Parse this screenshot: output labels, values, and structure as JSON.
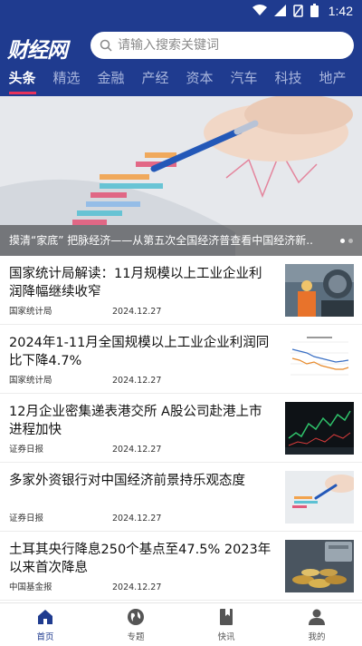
{
  "status_bar": {
    "time": "1:42",
    "icons": [
      "wifi-icon",
      "signal-icon",
      "no-sim-icon",
      "battery-icon"
    ]
  },
  "header": {
    "logo_text": "财经网",
    "search": {
      "placeholder": "请输入搜索关键词"
    },
    "tabs": [
      {
        "label": "头条",
        "active": true
      },
      {
        "label": "精选"
      },
      {
        "label": "金融"
      },
      {
        "label": "产经"
      },
      {
        "label": "资本"
      },
      {
        "label": "汽车"
      },
      {
        "label": "科技"
      },
      {
        "label": "地产"
      }
    ]
  },
  "banner": {
    "caption": "摸清“家底” 把脉经济——从第五次全国经济普查看中国经济新..",
    "slide_count": 2,
    "active_slide": 0
  },
  "news": [
    {
      "title": "国家统计局解读：11月规模以上工业企业利润降幅继续收窄",
      "source": "国家统计局",
      "date": "2024.12.27",
      "thumb": "factory-worker"
    },
    {
      "title": "2024年1-11月全国规模以上工业企业利润同比下降4.7%",
      "source": "国家统计局",
      "date": "2024.12.27",
      "thumb": "line-chart"
    },
    {
      "title": "12月企业密集递表港交所 A股公司赴港上市进程加快",
      "source": "证券日报",
      "date": "2024.12.27",
      "thumb": "stock-screen"
    },
    {
      "title": "多家外资银行对中国经济前景持乐观态度",
      "source": "证券日报",
      "date": "2024.12.27",
      "thumb": "hand-pen-chart"
    },
    {
      "title": "土耳其央行降息250个基点至47.5% 2023年以来首次降息",
      "source": "中国基金报",
      "date": "2024.12.27",
      "thumb": "coins"
    }
  ],
  "bottom_nav": [
    {
      "label": "首页",
      "icon": "home-icon",
      "active": true
    },
    {
      "label": "专题",
      "icon": "globe-icon"
    },
    {
      "label": "快讯",
      "icon": "bookmark-book-icon"
    },
    {
      "label": "我的",
      "icon": "person-icon"
    }
  ],
  "colors": {
    "brand": "#1f3b8f",
    "tab_indicator": "#e8325b"
  }
}
